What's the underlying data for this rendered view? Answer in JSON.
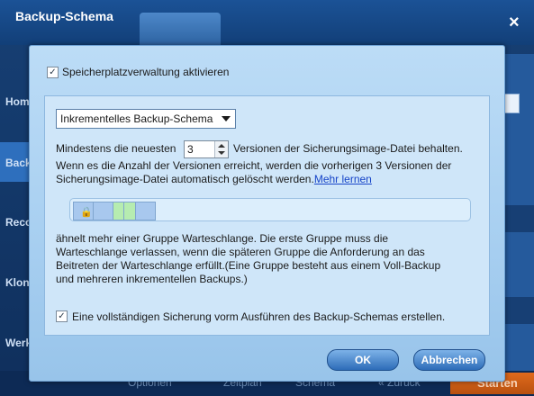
{
  "window": {
    "title": "Backup-Schema",
    "close_label": "×"
  },
  "sidebar": {
    "items": [
      {
        "label": "Hom"
      },
      {
        "label": "Back"
      },
      {
        "label": "Reco"
      },
      {
        "label": "Klon"
      },
      {
        "label": "Werk"
      }
    ]
  },
  "bottom_bar": {
    "options": "Optionen",
    "schedule": "Zeitplan",
    "schema": "Schema",
    "back": "« Zurück",
    "start": "Starten"
  },
  "dialog": {
    "enable_storage_label": "Speicherplatzverwaltung aktivieren",
    "enable_storage_checked": true,
    "scheme_select": {
      "value": "Inkrementelles Backup-Schema"
    },
    "keep_prefix": "Mindestens die neuesten",
    "keep_value": "3",
    "keep_suffix": "Versionen der Sicherungsimage-Datei behalten.",
    "explain_line2": "Wenn es die Anzahl der Versionen erreicht, werden die vorherigen 3 Versionen der",
    "explain_line3_prefix": "Sicherungsimage-Datei automatisch gelöscht werden.",
    "learn_more_link": "Mehr lernen",
    "queue_text_lines": [
      "ähnelt mehr einer Gruppe Warteschlange. Die erste Gruppe muss die",
      "Warteschlange verlassen, wenn die späteren Gruppe die Anforderung an das",
      "Beitreten der Warteschlange erfüllt.(Eine Gruppe besteht aus einem Voll-Backup",
      "und mehreren inkrementellen Backups.)"
    ],
    "full_backup_label": "Eine vollständigen Sicherung vorm Ausführen des Backup-Schemas erstellen.",
    "full_backup_checked": true,
    "ok_button": "OK",
    "cancel_button": "Abbrechen"
  },
  "colors": {
    "dialog_bg": "#a9d0f1",
    "block_blue": "#a8c8ee",
    "block_green": "#b6ecb0",
    "button_blue": "#2d6cb8",
    "start_orange": "#e06a1c"
  }
}
